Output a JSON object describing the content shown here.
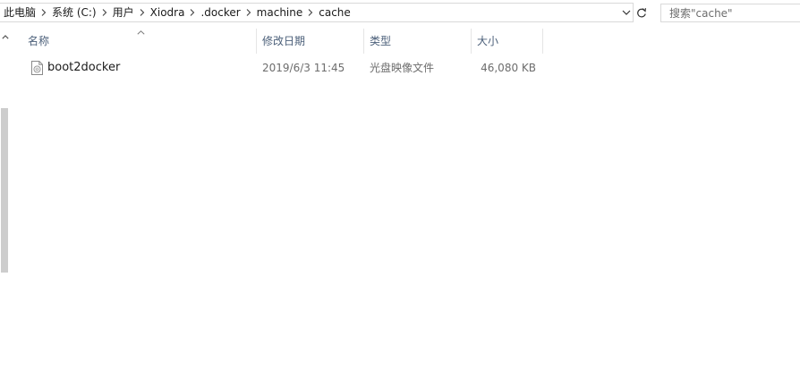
{
  "address_bar": {
    "breadcrumbs": [
      "此电脑",
      "系统 (C:)",
      "用户",
      "Xiodra",
      ".docker",
      "machine",
      "cache"
    ]
  },
  "search": {
    "placeholder": "搜索\"cache\""
  },
  "columns": {
    "name": "名称",
    "date": "修改日期",
    "type": "类型",
    "size": "大小"
  },
  "files": [
    {
      "name": "boot2docker",
      "date": "2019/6/3 11:45",
      "type": "光盘映像文件",
      "size": "46,080 KB",
      "icon": "disc-image-file-icon"
    }
  ],
  "colors": {
    "header_text": "#4c607a",
    "meta_text": "#6d6d6d",
    "scroll_thumb": "#cdcdcd"
  }
}
